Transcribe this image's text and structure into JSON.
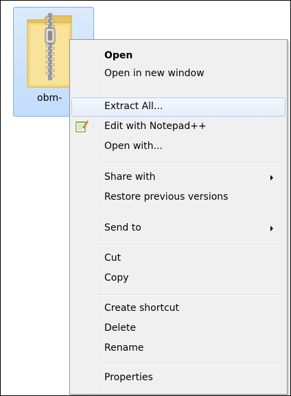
{
  "file": {
    "name": "obm-",
    "icon": "zip-folder-icon"
  },
  "context_menu": {
    "items": [
      {
        "label": "Open"
      },
      {
        "label": "Open in new window"
      },
      {
        "label": "Extract All..."
      },
      {
        "label": "Edit with Notepad++",
        "icon": "notepad-plus-plus-icon"
      },
      {
        "label": "Open with..."
      },
      {
        "label": "Share with",
        "submenu": true
      },
      {
        "label": "Restore previous versions"
      },
      {
        "label": "Send to",
        "submenu": true
      },
      {
        "label": "Cut"
      },
      {
        "label": "Copy"
      },
      {
        "label": "Create shortcut"
      },
      {
        "label": "Delete"
      },
      {
        "label": "Rename"
      },
      {
        "label": "Properties"
      }
    ]
  },
  "colors": {
    "selection_bg": "#c1dcfc",
    "hover_border": "#aecff7",
    "menu_bg": "#f0f0f0"
  }
}
